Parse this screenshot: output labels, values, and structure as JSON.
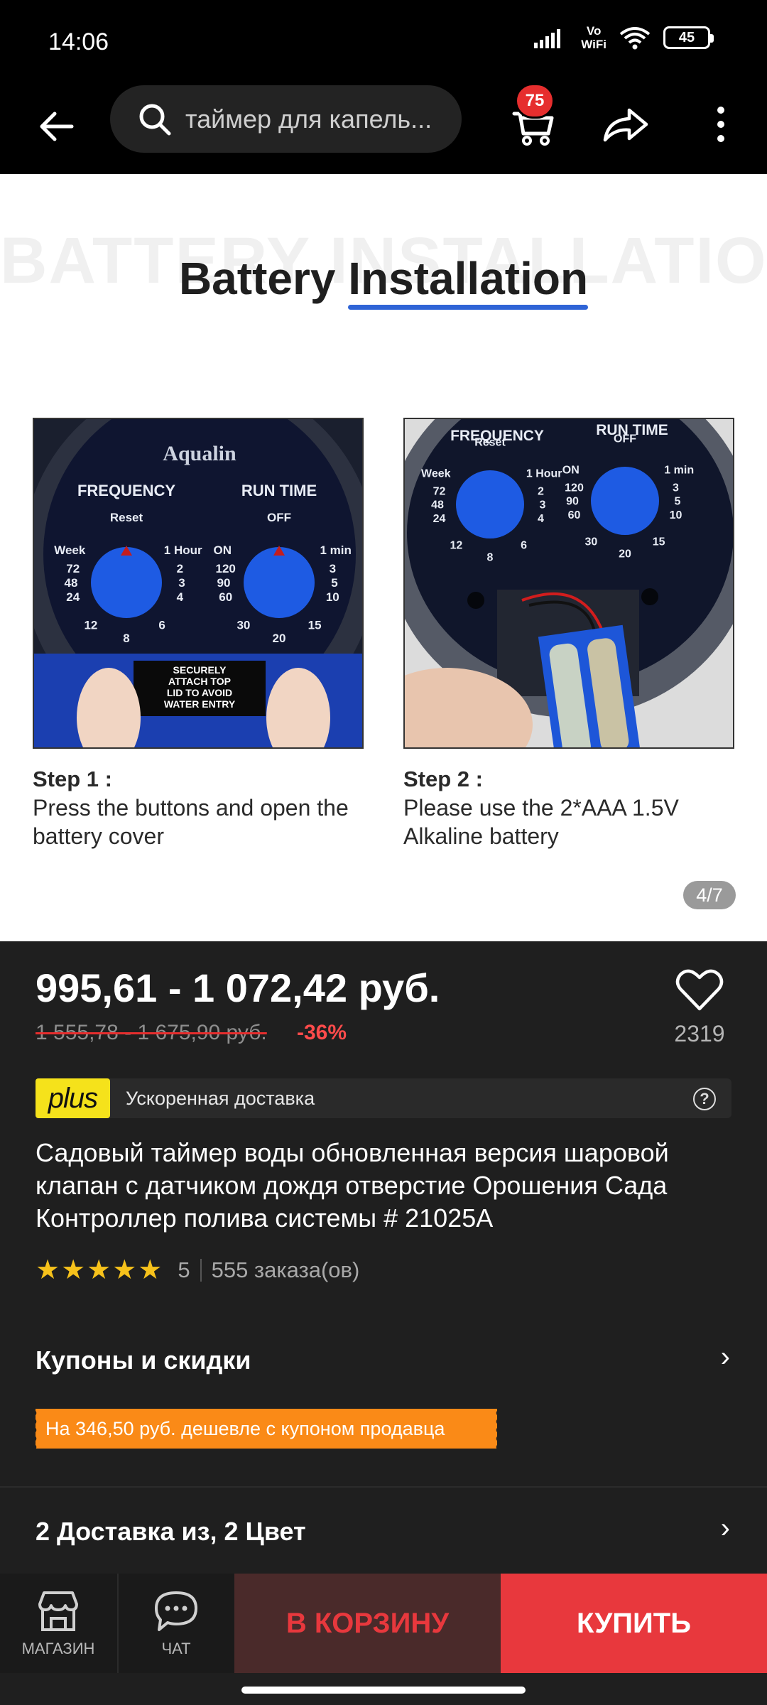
{
  "status_bar": {
    "time": "14:06",
    "vowifi_line1": "Vo",
    "vowifi_line2": "WiFi",
    "battery": "45"
  },
  "header": {
    "search_query": "таймер для капель...",
    "cart_badge": "75"
  },
  "gallery": {
    "bg_word": "BATTERY INSTALLATION",
    "title_part1": "Battery",
    "title_part2": "Installation",
    "photo1": {
      "brand": "Aqualin",
      "frequency": "FREQUENCY",
      "run_time": "RUN TIME",
      "freq_labels": [
        "Week",
        "Reset",
        "1 Hour",
        "72",
        "2",
        "48",
        "3",
        "24",
        "4",
        "12",
        "8",
        "6"
      ],
      "run_labels": [
        "ON",
        "OFF",
        "1 min",
        "120",
        "3",
        "90",
        "5",
        "60",
        "10",
        "30",
        "20",
        "15"
      ],
      "lid_text": [
        "SECURELY",
        "ATTACH TOP",
        "LID TO AVOID",
        "WATER ENTRY"
      ]
    },
    "photo2": {
      "frequency": "FREQUENCY",
      "run_time": "RUN TIME",
      "freq_labels": [
        "Week",
        "Reset",
        "1 Hour",
        "72",
        "2",
        "48",
        "3",
        "24",
        "4",
        "12",
        "8",
        "6"
      ],
      "run_labels": [
        "ON",
        "OFF",
        "1 min",
        "120",
        "3",
        "90",
        "5",
        "60",
        "10",
        "30",
        "20",
        "15"
      ]
    },
    "step1_heading": "Step 1 :",
    "step1_text": "Press the buttons and open the battery cover",
    "step2_heading": "Step 2 :",
    "step2_text": "Please use the 2*AAA 1.5V Alkaline battery",
    "pager": "4/7"
  },
  "product": {
    "price": "995,61 - 1 072,42 руб.",
    "old_price": "1 555,78 - 1 675,90 руб.",
    "discount": "-36%",
    "favorites": "2319",
    "plus_logo": "plus",
    "plus_text": "Ускоренная доставка",
    "title": "Садовый таймер воды обновленная версия шаровой клапан с датчиком дождя отверстие Орошения Сада Контроллер полива системы # 21025A",
    "rating": "5",
    "rating_stars": 5,
    "orders": "555 заказа(ов)"
  },
  "coupons": {
    "title": "Купоны и скидки",
    "tag": "На 346,50 руб. дешевле с купоном продавца"
  },
  "delivery": {
    "title": "2 Доставка из, 2 Цвет"
  },
  "bottom_bar": {
    "store_label": "МАГАЗИН",
    "chat_label": "ЧАТ",
    "add_to_cart": "В КОРЗИНУ",
    "buy": "КУПИТЬ"
  },
  "colors": {
    "accent_red": "#e8383d",
    "coupon_orange": "#fa8a17",
    "plus_yellow": "#f5e21b",
    "star_yellow": "#f7c21b"
  }
}
